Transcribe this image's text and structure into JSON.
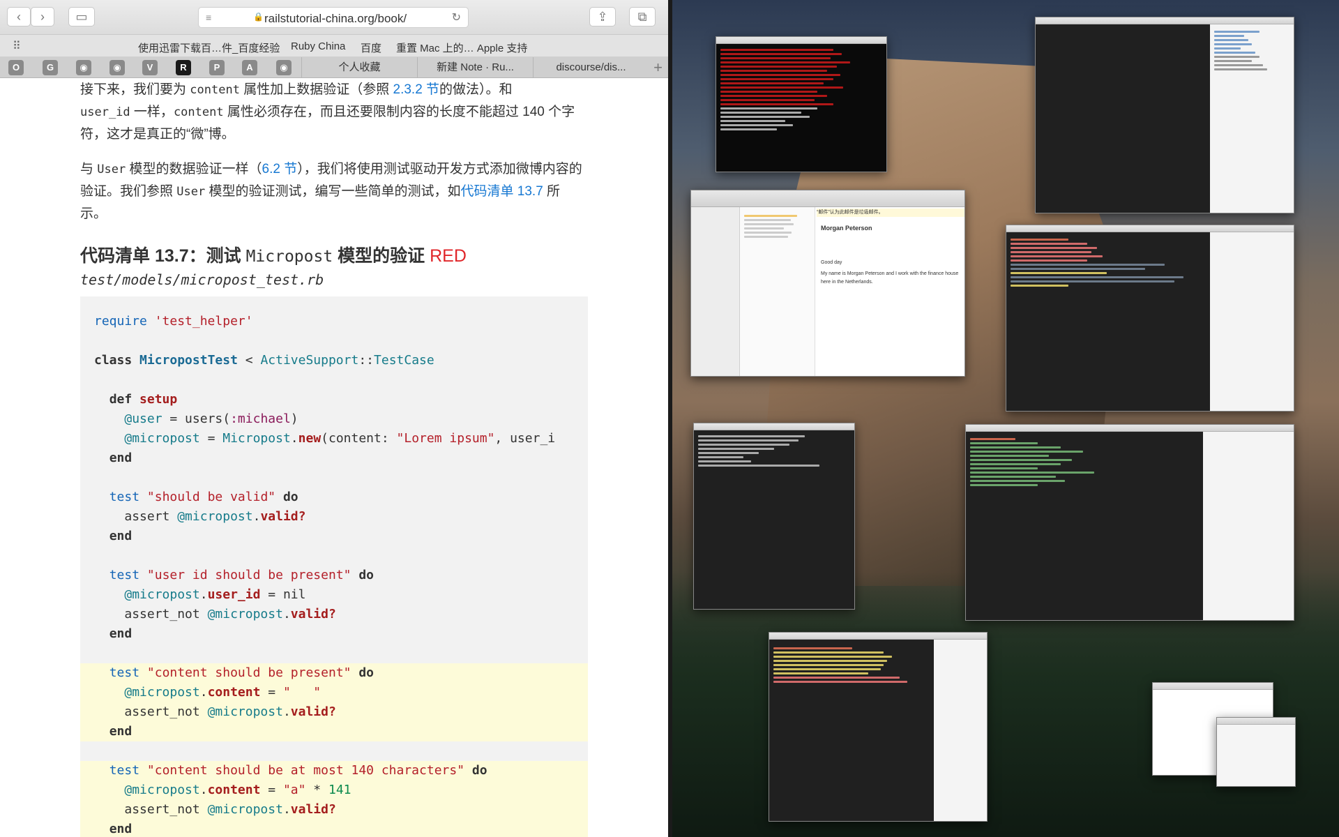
{
  "browser": {
    "url": "railstutorial-china.org/book/",
    "bookmarks": [
      "使用迅雷下载百…件_百度经验",
      "Ruby China",
      "百度",
      "重置 Mac 上的… Apple 支持"
    ],
    "fav_tabs": [
      "O",
      "G",
      "",
      "",
      "V",
      "R",
      "P",
      "A",
      ""
    ],
    "tabs": [
      "个人收藏",
      "新建 Note · Ru...",
      "discourse/dis..."
    ],
    "new_tab_glyph": "+"
  },
  "article": {
    "p1": {
      "t1": "接下来，我们要为 ",
      "c1": "content",
      "t2": " 属性加上数据验证（参照 ",
      "link": "2.3.2 节",
      "t3": "的做法）。和",
      "c2": "user_id",
      "t4": " 一样，",
      "c3": "content",
      "t5": " 属性必须存在，而且还要限制内容的长度不能超过 140 个字符，这才是真正的“微”博。"
    },
    "p2": {
      "t1": "与 ",
      "c1": "User",
      "t2": " 模型的数据验证一样（",
      "link1": "6.2 节",
      "t3": "），我们将使用测试驱动开发方式添加微博内容的验证。我们参照 ",
      "c2": "User",
      "t4": " 模型的验证测试，编写一些简单的测试，如",
      "link2": "代码清单 13.7",
      "t5": " 所示。"
    },
    "listing": {
      "prefix": "代码清单 13.7：测试 ",
      "mono": "Micropost",
      "suffix": " 模型的验证 ",
      "status": "RED",
      "filename": "test/models/micropost_test.rb"
    }
  },
  "code": {
    "l1": {
      "k": "require",
      "s": "'test_helper'"
    },
    "l3": {
      "k": "class",
      "c": "MicropostTest",
      "op": " < ",
      "m": "ActiveSupport",
      "sep": "::",
      "b": "TestCase"
    },
    "l5": {
      "k": "def",
      "m": "setup"
    },
    "l6": {
      "v": "@user",
      "eq": " = users(",
      "sym": ":michael",
      "end": ")"
    },
    "l7": {
      "v": "@micropost",
      "eq": " = ",
      "c": "Micropost",
      "dot": ".",
      "m": "new",
      "a": "(content: ",
      "s": "\"Lorem ipsum\"",
      "tail": ", user_i"
    },
    "end": "end",
    "t1": {
      "k": "test",
      "s": "\"should be valid\"",
      "d": "do"
    },
    "t1b": {
      "a": "assert ",
      "v": "@micropost",
      "dot": ".",
      "m": "valid?"
    },
    "t2": {
      "k": "test",
      "s": "\"user id should be present\"",
      "d": "do"
    },
    "t2b": {
      "v": "@micropost",
      "dot": ".",
      "m": "user_id",
      "rest": " = nil"
    },
    "t2c": {
      "a": "assert_not ",
      "v": "@micropost",
      "dot": ".",
      "m": "valid?"
    },
    "t3": {
      "k": "test",
      "s": "\"content should be present\"",
      "d": "do"
    },
    "t3b": {
      "v": "@micropost",
      "dot": ".",
      "m": "content",
      "eq": " = ",
      "s": "\"   \""
    },
    "t4": {
      "k": "test",
      "s": "\"content should be at most 140 characters\"",
      "d": "do"
    },
    "t4b": {
      "v": "@micropost",
      "dot": ".",
      "m": "content",
      "eq": " = ",
      "s": "\"a\"",
      "op": " * ",
      "n": "141"
    }
  },
  "mail": {
    "sender": "Morgan Peterson",
    "banner": "“邮件”认为此邮件是垃圾邮件。",
    "body": [
      "Good day",
      "My name is Morgan Peterson and I work with the finance house here in the Netherlands."
    ]
  }
}
